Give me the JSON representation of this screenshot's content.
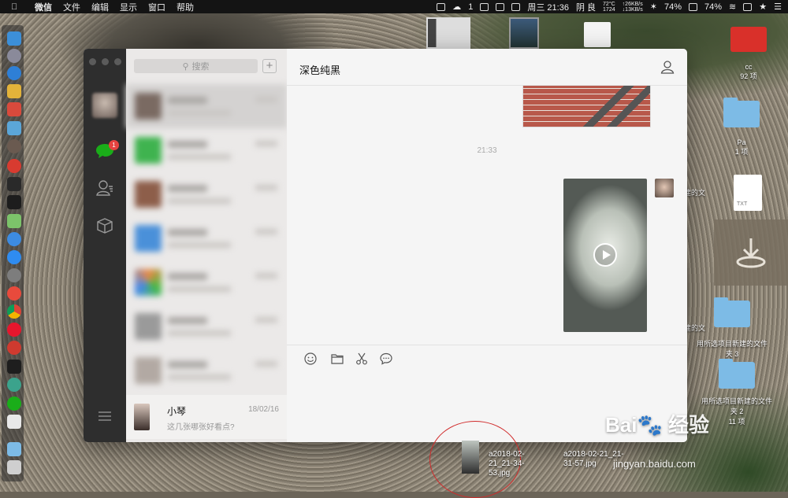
{
  "menubar": {
    "app": "微信",
    "items": [
      "文件",
      "编辑",
      "显示",
      "窗口",
      "帮助"
    ],
    "wechat_count": "1",
    "clock": "周三 21:36",
    "weather": "阴 良",
    "sys_temp": "72°C",
    "sys_rpm": "1724",
    "net_up": "↑26KB/s",
    "net_down": "↓13KB/s",
    "battery1": "74%",
    "battery2": "74%"
  },
  "sidebar": {
    "search_placeholder": "搜索",
    "add_label": "+",
    "unread_badge": "1",
    "visible_contact": {
      "name": "小琴",
      "date": "18/02/16",
      "preview": "这几张哪张好看点?"
    }
  },
  "chat": {
    "title": "深色纯黑",
    "timestamp": "21:33"
  },
  "desktop": {
    "items": [
      {
        "label": "cc",
        "sub": "92 项"
      },
      {
        "label": "Pa",
        "sub": "1 项"
      },
      {
        "label": "建的文"
      },
      {
        "label": "TXT"
      },
      {
        "label": "建的文"
      },
      {
        "label": "用所选项目新建的文件夹 3"
      },
      {
        "label": "用所选项目新建的文件夹 2",
        "sub": "11 项"
      }
    ],
    "dragged_files": [
      "a2018-02-21_21-34-53.jpg",
      "a2018-02-21_21-31-57.jpg"
    ]
  },
  "watermark": {
    "brand": "Bai🐾 经验",
    "url": "jingyan.baidu.com"
  },
  "colors": {
    "wechat_green": "#1aad19",
    "badge_red": "#e64340",
    "nav_bg": "#2e2e2e"
  }
}
